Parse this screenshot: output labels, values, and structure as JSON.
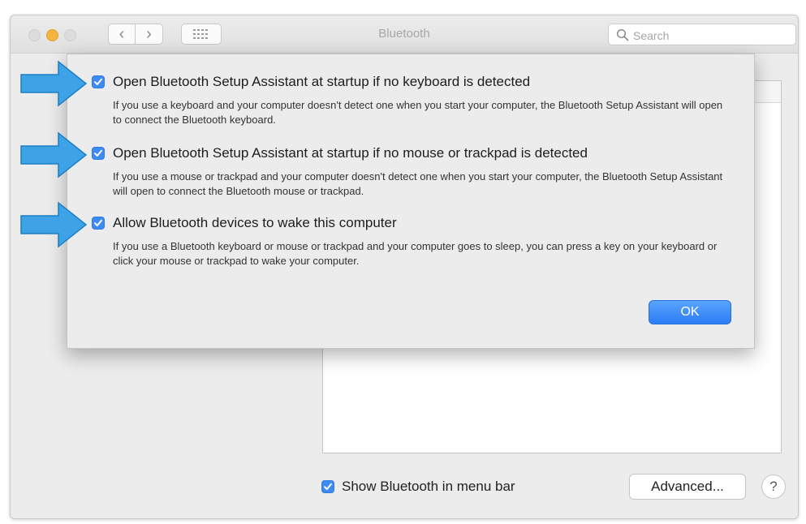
{
  "window": {
    "title": "Bluetooth"
  },
  "toolbar": {
    "back_glyph": "‹",
    "forward_glyph": "›"
  },
  "search": {
    "placeholder": "Search",
    "value": ""
  },
  "sheet": {
    "options": [
      {
        "checked": true,
        "title": "Open Bluetooth Setup Assistant at startup if no keyboard is detected",
        "description": "If you use a keyboard and your computer doesn't detect one when you start your computer, the Bluetooth Setup Assistant will open to connect the Bluetooth keyboard."
      },
      {
        "checked": true,
        "title": "Open Bluetooth Setup Assistant at startup if no mouse or trackpad is detected",
        "description": "If you use a mouse or trackpad and your computer doesn't detect one when you start your computer, the Bluetooth Setup Assistant will open to connect the Bluetooth mouse or trackpad."
      },
      {
        "checked": true,
        "title": "Allow Bluetooth devices to wake this computer",
        "description": "If you use a Bluetooth keyboard or mouse or trackpad and your computer goes to sleep, you can press a key on your keyboard or click your mouse or trackpad to wake your computer."
      }
    ],
    "ok_label": "OK"
  },
  "footer": {
    "show_in_menu_bar_checked": true,
    "show_in_menu_bar_label": "Show Bluetooth in menu bar",
    "advanced_label": "Advanced...",
    "help_label": "?"
  },
  "colors": {
    "accent": "#3c8af2",
    "arrow": "#3da2e6",
    "traffic_light_minimize": "#f5b53d"
  }
}
